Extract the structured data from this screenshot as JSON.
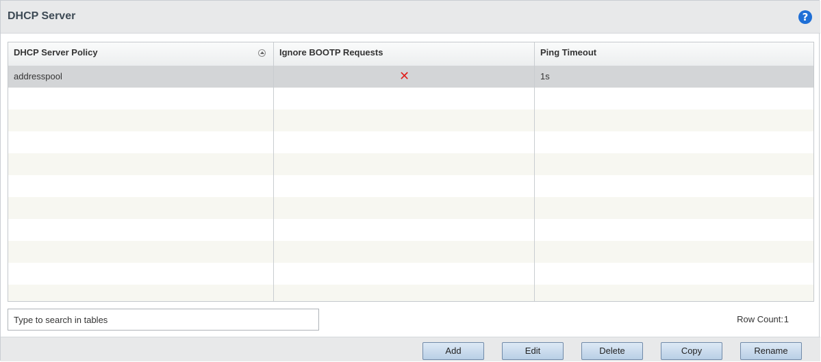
{
  "header": {
    "title": "DHCP Server"
  },
  "table": {
    "columns": [
      "DHCP Server Policy",
      "Ignore BOOTP Requests",
      "Ping Timeout"
    ],
    "rows": [
      {
        "policy": "addresspool",
        "ignore_bootp_icon": "x-cross-icon",
        "ping_timeout": "1s"
      }
    ]
  },
  "search": {
    "placeholder": "Type to search in tables"
  },
  "row_count": {
    "label": "Row Count:",
    "value": "1"
  },
  "buttons": {
    "add": "Add",
    "edit": "Edit",
    "delete": "Delete",
    "copy": "Copy",
    "rename": "Rename"
  },
  "colors": {
    "help": "#1f6fd6",
    "cross": "#e0201c",
    "button_border": "#6f89a8"
  }
}
